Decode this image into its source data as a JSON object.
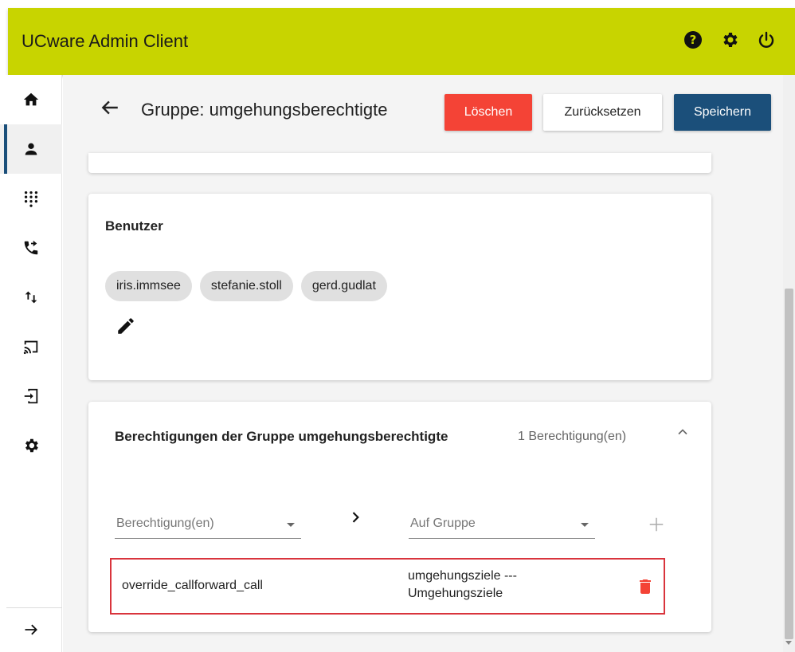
{
  "app": {
    "title": "UCware Admin Client"
  },
  "topbar": {
    "icons": [
      "help-icon",
      "gear-icon",
      "power-icon"
    ],
    "color": "#c8d400"
  },
  "sidebar": {
    "items": [
      {
        "icon": "home-icon",
        "active": false
      },
      {
        "icon": "user-icon",
        "active": true
      },
      {
        "icon": "dialpad-icon",
        "active": false
      },
      {
        "icon": "phone-forward-icon",
        "active": false
      },
      {
        "icon": "swap-vert-icon",
        "active": false
      },
      {
        "icon": "cast-icon",
        "active": false
      },
      {
        "icon": "login-icon",
        "active": false
      },
      {
        "icon": "settings-icon",
        "active": false
      }
    ],
    "expand_icon": "arrow-right-icon"
  },
  "header": {
    "title": "Gruppe: umgehungsberechtigte",
    "buttons": {
      "delete": "Löschen",
      "reset": "Zurücksetzen",
      "save": "Speichern"
    },
    "colors": {
      "delete": "#f44336",
      "save": "#1b4f7a"
    }
  },
  "users_card": {
    "title": "Benutzer",
    "chips": [
      "iris.immsee",
      "stefanie.stoll",
      "gerd.gudlat"
    ]
  },
  "permissions_card": {
    "title": "Berechtigungen der Gruppe umgehungsberechtigte",
    "count": "1 Berechtigung(en)",
    "permission_select_placeholder": "Berechtigung(en)",
    "group_select_placeholder": "Auf Gruppe",
    "rows": [
      {
        "permission": "override_callforward_call",
        "target_line1": "umgehungsziele ---",
        "target_line2": "Umgehungsziele"
      }
    ]
  }
}
